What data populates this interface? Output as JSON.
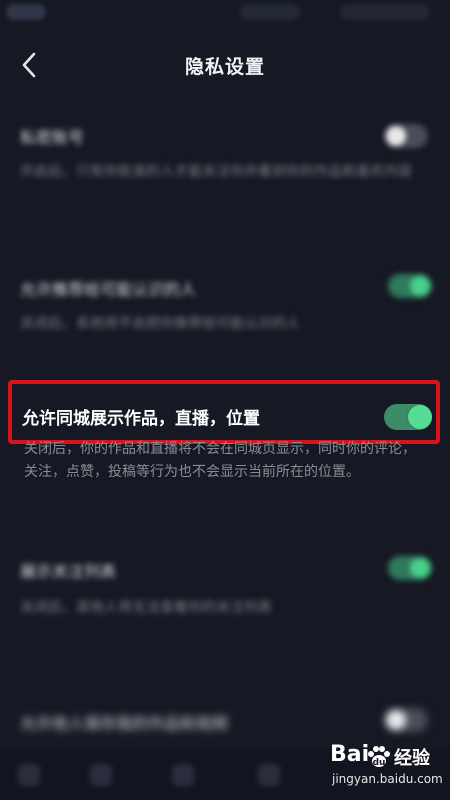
{
  "header": {
    "title": "隐私设置"
  },
  "highlighted_setting": {
    "title": "允许同城展示作品，直播，位置",
    "description": "关闭后，你的作品和直播将不会在同城页显示，同时你的评论，关注，点赞，投稿等行为也不会显示当前所在的位置。",
    "enabled": true
  },
  "blurred_settings": [
    {
      "title": "私密账号",
      "description": "开启后，只有你批准的人才能关注你并看到你的作品和喜欢内容",
      "enabled": false
    },
    {
      "title": "允许推荐给可能认识的人",
      "description": "关闭后，系统将不会把你推荐给可能认识的人",
      "enabled": true
    },
    {
      "title": "展示关注列表",
      "description": "关闭后，其他人将无法查看你的关注列表",
      "enabled": true
    },
    {
      "title": "允许他人保存我的作品和视频",
      "description": "",
      "enabled": false
    }
  ],
  "watermark": {
    "brand": "Bai",
    "brand_suffix": "经验",
    "url": "jingyan.baidu.com"
  },
  "colors": {
    "background": "#161823",
    "toggle_on": "#55dc92",
    "highlight_border": "#d8141a"
  }
}
